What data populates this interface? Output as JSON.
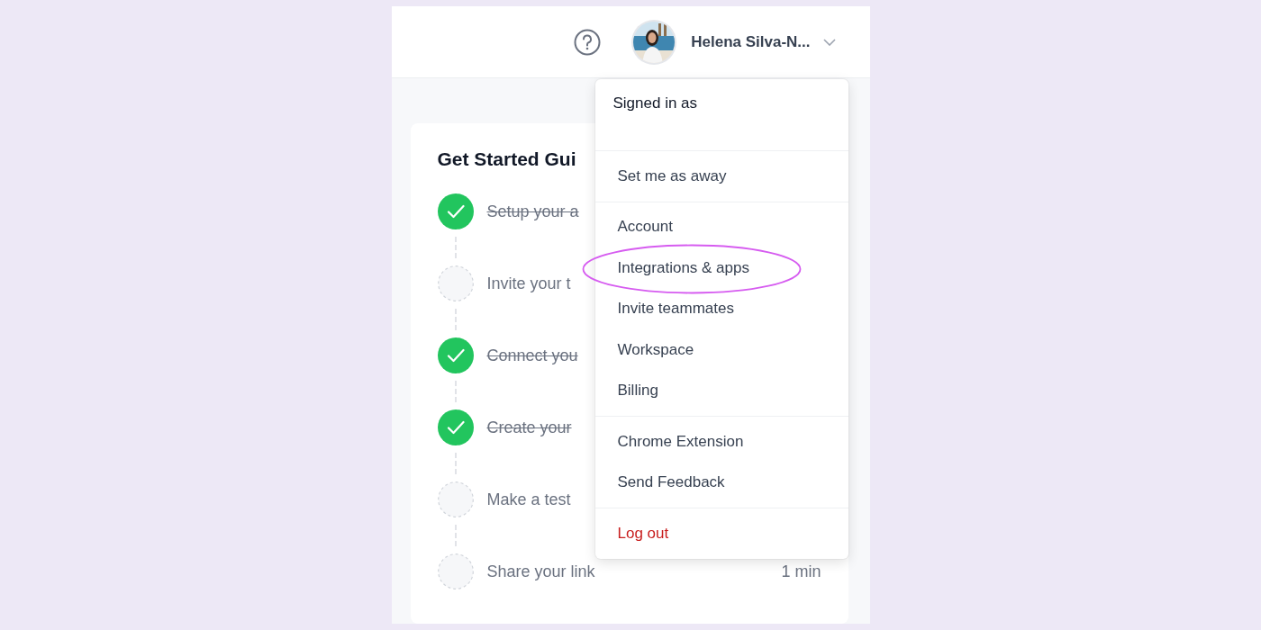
{
  "header": {
    "user_name": "Helena Silva-N..."
  },
  "guide": {
    "title": "Get Started Gui",
    "steps": [
      {
        "label": "Setup your a",
        "done": true
      },
      {
        "label": "Invite your t",
        "done": false
      },
      {
        "label": "Connect you",
        "done": true
      },
      {
        "label": "Create your",
        "done": true
      },
      {
        "label": "Make a test",
        "done": false
      },
      {
        "label": "Share your link",
        "done": false,
        "duration": "1 min"
      }
    ]
  },
  "menu": {
    "signed_in_label": "Signed in as",
    "sections": [
      [
        {
          "label": "Set me as away",
          "kind": "normal",
          "highlighted": false
        }
      ],
      [
        {
          "label": "Account",
          "kind": "normal",
          "highlighted": false
        },
        {
          "label": "Integrations & apps",
          "kind": "normal",
          "highlighted": true
        },
        {
          "label": "Invite teammates",
          "kind": "normal",
          "highlighted": false
        },
        {
          "label": "Workspace",
          "kind": "normal",
          "highlighted": false
        },
        {
          "label": "Billing",
          "kind": "normal",
          "highlighted": false
        }
      ],
      [
        {
          "label": "Chrome Extension",
          "kind": "normal",
          "highlighted": false
        },
        {
          "label": "Send Feedback",
          "kind": "normal",
          "highlighted": false
        }
      ],
      [
        {
          "label": "Log out",
          "kind": "danger",
          "highlighted": false
        }
      ]
    ]
  }
}
